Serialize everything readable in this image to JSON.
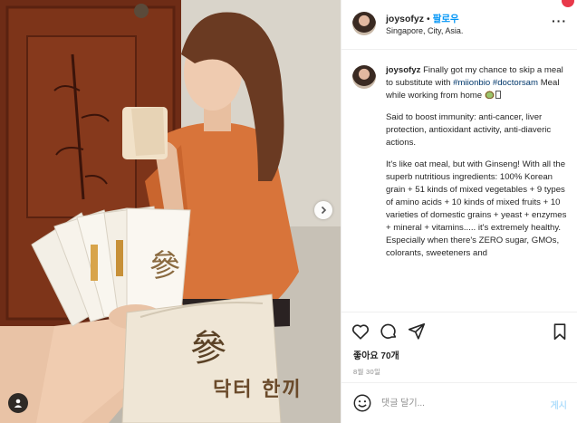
{
  "post": {
    "username": "joysofyz",
    "follow_label": "팔로우",
    "location": "Singapore, City, Asia.",
    "caption": {
      "username": "joysofyz",
      "intro": "Finally got my chance to skip a meal to substitute with",
      "hashtag1": "#miionbio",
      "hashtag2": "#doctorsam",
      "intro_end": "Meal while working from home",
      "para2": "Said to boost immunity: anti-cancer, liver protection, antioxidant activity, anti-diaveric actions.",
      "para3": "It's like oat meal, but with Ginseng! With all the superb nutritious ingredients: 100% Korean grain + 51 kinds of mixed vegetables + 9 types of amino acids + 10 kinds of mixed fruits + 10 varieties of domestic grains + yeast + enzymes + mineral + vitamins..... it's extremely healthy. Especially when there's ZERO sugar, GMOs, colorants, sweeteners and"
    },
    "likes": "좋아요 70개",
    "date": "8월 30일",
    "comment_placeholder": "댓글 달기...",
    "post_button": "게시"
  },
  "photo": {
    "package_text": "닥터 한끼",
    "package_logo": "參"
  },
  "icons": {
    "more": "more-options-icon",
    "like": "heart-icon",
    "comment": "comment-icon",
    "share": "paper-plane-icon",
    "save": "bookmark-icon",
    "emoji": "smiley-icon",
    "next": "chevron-right-icon",
    "tag": "user-tag-icon"
  },
  "colors": {
    "accent": "#0095f6",
    "hashtag": "#00376b",
    "muted": "#8e8e8e",
    "post_disabled": "#b2dffc"
  }
}
